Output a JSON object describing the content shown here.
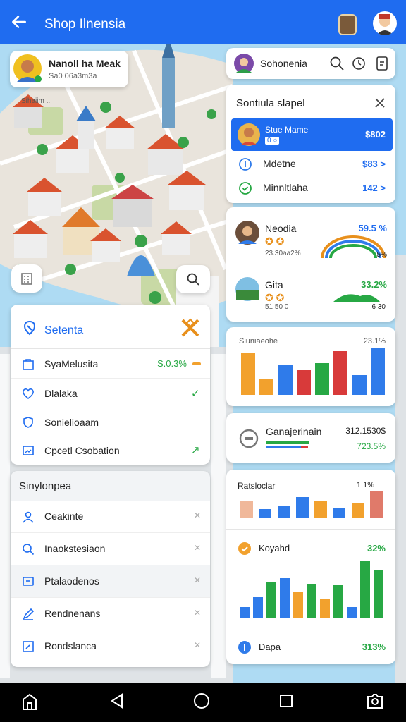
{
  "colors": {
    "accent": "#1f6cf0",
    "green": "#27a844",
    "orange": "#f2a12d",
    "red": "#d83a3a",
    "blue": "#2f7bea"
  },
  "appbar": {
    "title": "Shop Ilnensia"
  },
  "location_tag": {
    "name": "Nanoll ha Meak",
    "sub": "Sa0 06a3m3a",
    "map_label": "Sihaiim ..."
  },
  "top_panel": {
    "title": "Sohonenia"
  },
  "list_card": {
    "title": "Sontiula slapel",
    "rows": [
      {
        "label": "Stue Mame",
        "sub": "0 ○",
        "value": "$802",
        "selected": true
      },
      {
        "label": "Mdetne",
        "value": "$83 >"
      },
      {
        "label": "Minnltlaha",
        "value": "142 >"
      }
    ]
  },
  "stats_card": {
    "items": [
      {
        "label": "Neodia",
        "value": "59.5 %",
        "stars": "✪ ✪",
        "sub": "23.30aa2%",
        "tail": "5%"
      },
      {
        "label": "Gita",
        "value": "33.2%",
        "stars": "✪ ✪",
        "sub": "51 50 0",
        "tail": "6 30"
      }
    ]
  },
  "bar_chart1": {
    "title": "Siuniaeohe",
    "value": "23.1%",
    "values": [
      60,
      22,
      42,
      35,
      45,
      62,
      28,
      66
    ]
  },
  "progress_card": {
    "label": "Ganajerinain",
    "value1": "312.1530$",
    "value2": "723.5%"
  },
  "bar_chart2": {
    "title": "Ratsloclar",
    "value": "1.1%",
    "values": [
      20,
      10,
      14,
      24,
      20,
      12,
      18,
      32
    ]
  },
  "bar_chart3": {
    "label": "Koyahd",
    "value": "32%",
    "footer_label": "Dapa",
    "footer_value": "313%",
    "values": [
      12,
      24,
      42,
      46,
      30,
      40,
      22,
      38,
      12,
      66,
      56
    ]
  },
  "settings_card": {
    "title": "Setenta",
    "rows": [
      {
        "label": "SyaMelusita",
        "value": "S.0.3%",
        "icon": "bag-icon"
      },
      {
        "label": "Dlalaka",
        "value": "✓",
        "icon": "heart-icon"
      },
      {
        "label": "Sonielioaam",
        "value": "",
        "icon": "shield-icon"
      },
      {
        "label": "Cpcetl Csobation",
        "value": "↗",
        "icon": "image-icon"
      }
    ]
  },
  "menu_card": {
    "title": "Sinylonpea",
    "rows": [
      {
        "label": "Ceakinte",
        "icon": "user-icon"
      },
      {
        "label": "Inaokstesiaon",
        "icon": "search-icon"
      },
      {
        "label": "Ptalaodenos",
        "icon": "chat-icon"
      },
      {
        "label": "Rendnenans",
        "icon": "pen-icon"
      },
      {
        "label": "Rondslanca",
        "icon": "edit-icon"
      }
    ]
  }
}
